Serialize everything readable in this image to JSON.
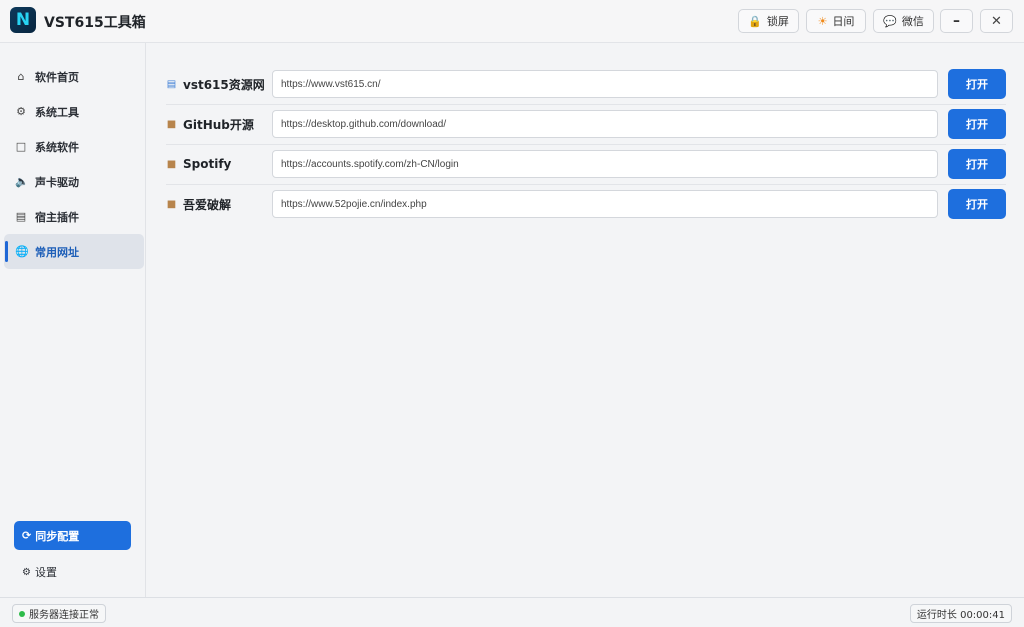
{
  "app": {
    "logo_letter": "N",
    "title": "VST615工具箱"
  },
  "toolbar": {
    "lock": {
      "icon": "lock-icon",
      "label": "锁屏"
    },
    "day": {
      "icon": "sun-icon",
      "label": "日间"
    },
    "wechat": {
      "icon": "chat-icon",
      "label": "微信"
    },
    "minimize_icon": "minimize-icon",
    "close_icon": "close-icon"
  },
  "sidebar": {
    "items": [
      {
        "icon": "home-icon",
        "label": "软件首页",
        "active": false
      },
      {
        "icon": "gear-icon",
        "label": "系统工具",
        "active": false
      },
      {
        "icon": "folder-icon",
        "label": "系统软件",
        "active": false
      },
      {
        "icon": "speaker-icon",
        "label": "声卡驱动",
        "active": false
      },
      {
        "icon": "document-icon",
        "label": "宿主插件",
        "active": false
      },
      {
        "icon": "globe-icon",
        "label": "常用网址",
        "active": true
      }
    ],
    "sync_button": "同步配置",
    "settings_label": "设置"
  },
  "links": [
    {
      "icon": "chart-icon",
      "name": "vst615资源网",
      "url": "https://www.vst615.cn/",
      "button": "打开"
    },
    {
      "icon": "package-icon",
      "name": "GitHub开源",
      "url": "https://desktop.github.com/download/",
      "button": "打开"
    },
    {
      "icon": "package-icon",
      "name": "Spotify",
      "url": "https://accounts.spotify.com/zh-CN/login",
      "button": "打开"
    },
    {
      "icon": "package-icon",
      "name": "吾爱破解",
      "url": "https://www.52pojie.cn/index.php",
      "button": "打开"
    }
  ],
  "status": {
    "connection": "服务器连接正常",
    "connection_color": "#2dbb4a",
    "uptime": "运行时长 00:00:41"
  },
  "colors": {
    "accent": "#1e6fde",
    "logo_bg": "#0e3a5c",
    "logo_fg": "#28d4f3"
  }
}
